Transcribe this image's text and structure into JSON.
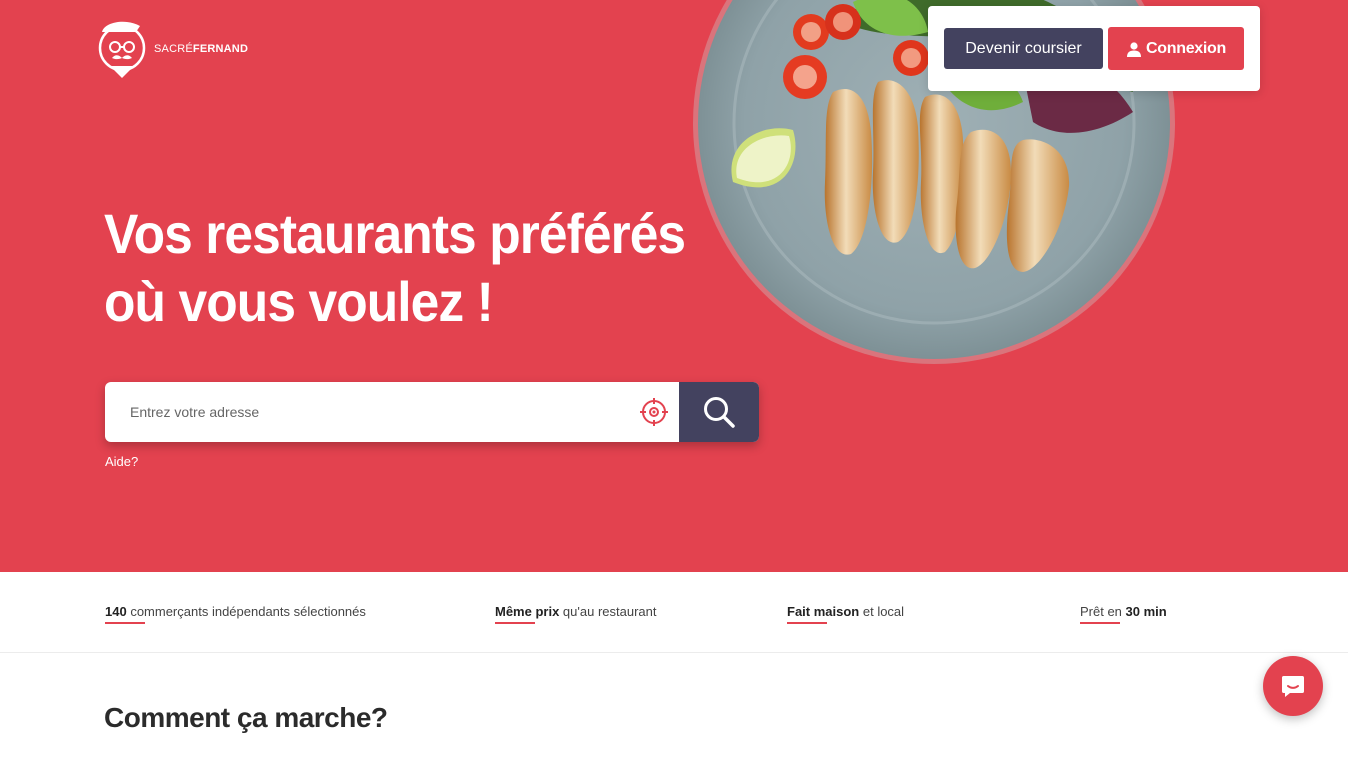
{
  "brand": {
    "light": "SACRÉ",
    "bold": "FERNAND",
    "color": "#e3424f",
    "dark": "#43425f"
  },
  "nav": {
    "coursier_label": "Devenir coursier",
    "connexion_label": "Connexion"
  },
  "hero": {
    "line1": "Vos restaurants préférés",
    "line2": "où vous voulez !"
  },
  "search": {
    "placeholder": "Entrez votre adresse",
    "help": "Aide?"
  },
  "features": [
    {
      "bold": "140",
      "text": " commerçants indépendants sélectionnés"
    },
    {
      "bold": "Même prix",
      "text": " qu'au restaurant"
    },
    {
      "bold": "Fait maison",
      "text": " et local"
    },
    {
      "pre": "Prêt en ",
      "bold": "30 min"
    }
  ],
  "section": {
    "title": "Comment ça marche?"
  }
}
